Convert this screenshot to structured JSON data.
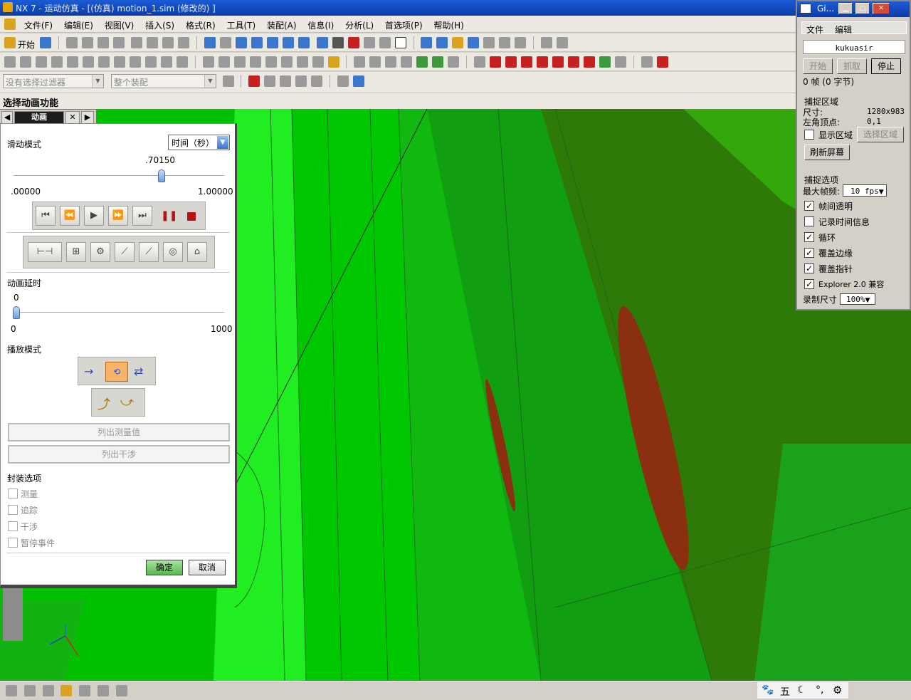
{
  "titlebar": {
    "title": "NX 7 - 运动仿真 - [(仿真) motion_1.sim  (修改的) ]"
  },
  "menubar": {
    "items": [
      "文件(F)",
      "编辑(E)",
      "视图(V)",
      "插入(S)",
      "格式(R)",
      "工具(T)",
      "装配(A)",
      "信息(I)",
      "分析(L)",
      "首选项(P)",
      "帮助(H)"
    ]
  },
  "toolbar": {
    "start_label": "开始"
  },
  "filters": {
    "type_filter": "没有选择过滤器",
    "scope_filter": "整个装配"
  },
  "section_title": "选择动画功能",
  "panel": {
    "tab_label": "动画",
    "slide_mode_label": "滑动模式",
    "slide_mode_value": "时间（秒）",
    "slider_value": ".70150",
    "slider_fraction": 0.7015,
    "slider_min": ".00000",
    "slider_max": "1.00000",
    "delay_label": "动画延时",
    "delay_value": "0",
    "delay_min": "0",
    "delay_max": "1000",
    "play_mode_label": "播放模式",
    "list_measure": "列出测量值",
    "list_interference": "列出干涉",
    "envelope_label": "封装选项",
    "envelope_options": [
      "测量",
      "追踪",
      "干涉",
      "暂停事件"
    ],
    "ok": "确定",
    "cancel": "取消"
  },
  "gif": {
    "title": "Gi...",
    "menu": [
      "文件",
      "编辑"
    ],
    "user": "kukuasir",
    "btn_start": "开始",
    "btn_grab": "抓取",
    "btn_stop": "停止",
    "frames": "0 帧 (0 字节)",
    "capture_area": "捕捉区域",
    "size_label": "尺寸:",
    "size_value": "1280x983",
    "origin_label": "左角顶点:",
    "origin_value": "0,1",
    "show_area": "显示区域",
    "select_area": "选择区域",
    "refresh": "刷新屏幕",
    "capture_options": "捕捉选项",
    "max_fps_label": "最大帧频:",
    "max_fps": "10 fps",
    "opt_transparent": "帧间透明",
    "opt_time": "记录时间信息",
    "opt_loop": "循环",
    "opt_edge": "覆盖边缘",
    "opt_cursor": "覆盖指针",
    "opt_explorer": "Explorer 2.0 兼容",
    "rec_size_label": "录制尺寸",
    "rec_size": "100%"
  },
  "tray": {
    "ime": "五"
  },
  "colors": {
    "viewport_green": "#00c400",
    "dark_green": "#2a7a00",
    "red_slot": "#8a3010"
  }
}
